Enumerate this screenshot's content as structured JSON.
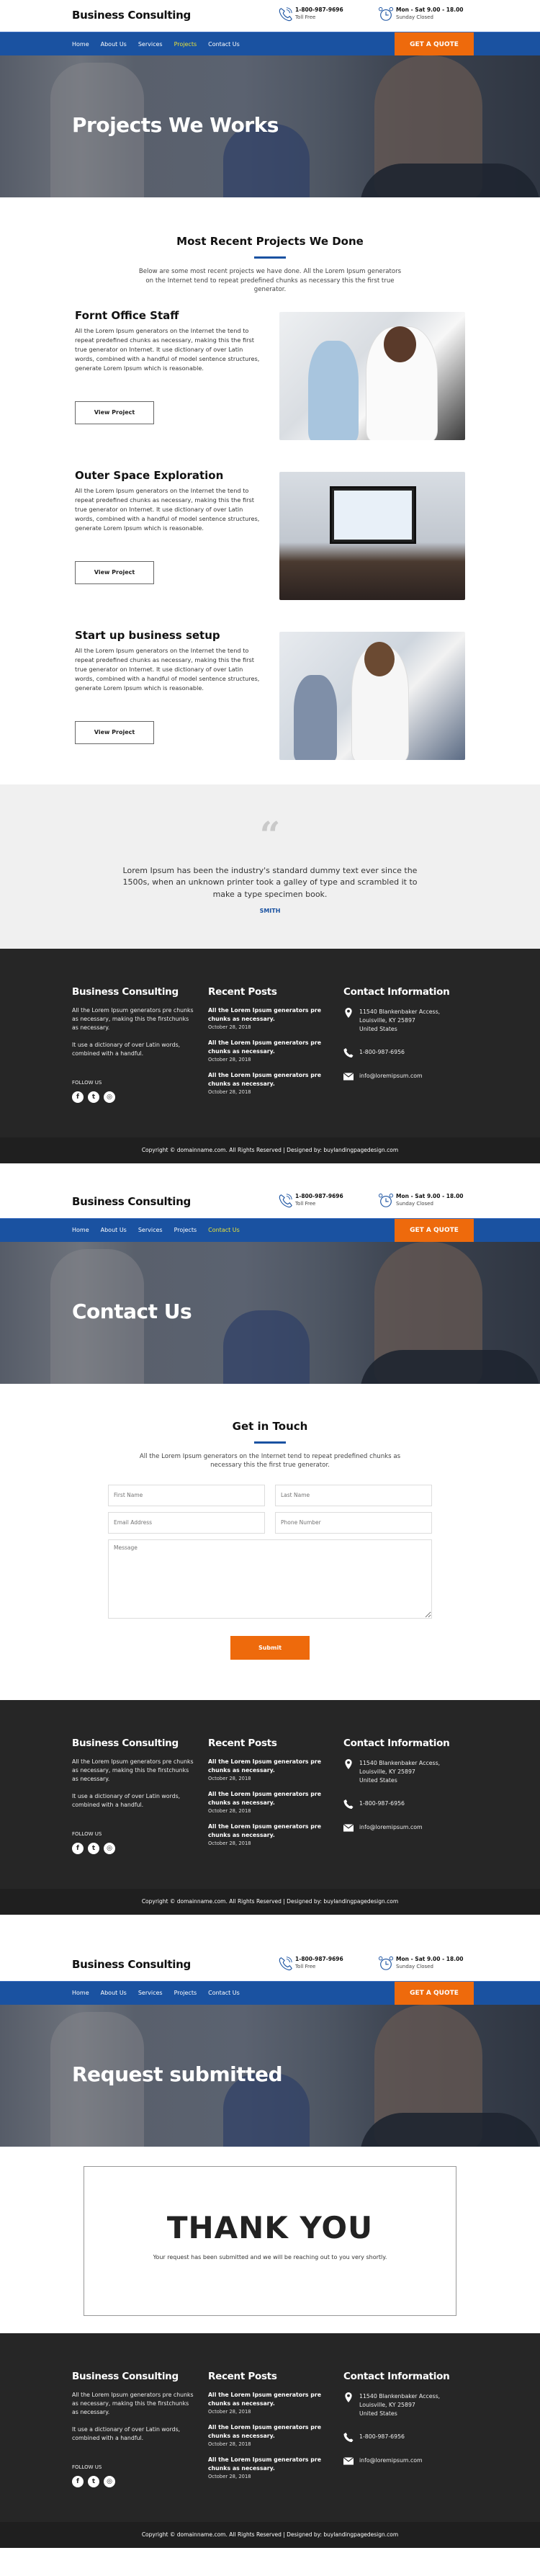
{
  "site": {
    "logo": "Business Consulting",
    "phone": "1-800-987-9696",
    "phone_label": "Toll Free",
    "hours": "Mon - Sat 9.00 - 18.00",
    "hours_label": "Sunday Closed",
    "nav": [
      "Home",
      "About Us",
      "Services",
      "Projects",
      "Contact Us"
    ],
    "quote_button": "GET A QUOTE",
    "colors": {
      "primary": "#1a52a1",
      "accent": "#ee6a0c",
      "active_nav": "#e8e23a",
      "footer_bg": "#262626"
    }
  },
  "pages": [
    {
      "hero_title": "Projects We Works",
      "active_nav": "Projects"
    },
    {
      "hero_title": "Contact Us",
      "active_nav": "Contact Us"
    },
    {
      "hero_title": "Request submitted",
      "active_nav": null
    }
  ],
  "projects_section": {
    "title": "Most Recent Projects We Done",
    "description": "Below are some most recent projects we have done. All the Lorem Ipsum generators on the Internet tend to repeat predefined chunks as necessary this the first true generator.",
    "items": [
      {
        "title": "Fornt Office Staff",
        "text": "All the Lorem Ipsum generators on the Internet the tend to repeat predefined chunks as necessary, making this the first true generator on Internet. It use dictionary of over Latin words, combined with a handful of model sentence structures, generate Lorem Ipsum which is reasonable.",
        "button": "View Project",
        "image": "call-center-staff-photo"
      },
      {
        "title": "Outer Space Exploration",
        "text": "All the Lorem Ipsum generators on the Internet the tend to repeat predefined chunks as necessary, making this the first true generator on Internet. It use dictionary of over Latin words, combined with a handful of model sentence structures, generate Lorem Ipsum which is reasonable.",
        "button": "View Project",
        "image": "meeting-room-photo"
      },
      {
        "title": "Start up business setup",
        "text": "All the Lorem Ipsum generators on the Internet the tend to repeat predefined chunks as necessary, making this the first true generator on Internet. It use dictionary of over Latin words, combined with a handful of model sentence structures, generate Lorem Ipsum which is reasonable.",
        "button": "View Project",
        "image": "business-team-photo"
      }
    ]
  },
  "testimonial": {
    "quote": "Lorem Ipsum has been the industry's standard dummy text ever since the 1500s, when an unknown printer took a galley of type and scrambled it to make a type specimen book.",
    "author": "SMITH"
  },
  "contact_section": {
    "title": "Get in Touch",
    "description": "All the Lorem Ipsum generators on the Internet tend to repeat predefined chunks as necessary this the first true generator.",
    "placeholders": {
      "first_name": "First Name",
      "last_name": "Last Name",
      "email": "Email Address",
      "phone": "Phone Number",
      "message": "Message"
    },
    "submit": "Submit"
  },
  "thank_you": {
    "title": "THANK YOU",
    "message": "Your request has been submitted and we will be reaching out to you very shortly."
  },
  "footer": {
    "about_title": "Business Consulting",
    "about_p1": "All the Lorem Ipsum generators pre chunks as necessary, making this the firstchunks as necessary.",
    "about_p2": "It use a dictionary of over Latin words, combined with a handful.",
    "follow_label": "FOLLOW US",
    "social": [
      "facebook",
      "twitter",
      "instagram"
    ],
    "posts_title": "Recent Posts",
    "posts": [
      {
        "title": "All the Lorem Ipsum generators pre chunks as necessary.",
        "date": "October 28, 2018"
      },
      {
        "title": "All the Lorem Ipsum generators pre chunks as necessary.",
        "date": "October 28, 2018"
      },
      {
        "title": "All the Lorem Ipsum generators pre chunks as necessary.",
        "date": "October 28, 2018"
      }
    ],
    "contact_title": "Contact Information",
    "address_line1": "11540 Blankenbaker Access,",
    "address_line2": "Louisville, KY 25897",
    "address_line3": "United States",
    "phone": "1-800-987-6956",
    "email": "info@loremipsum.com",
    "copyright": "Copyright © domainname.com. All Rights Reserved | Designed by: buylandingpagedesign.com"
  }
}
